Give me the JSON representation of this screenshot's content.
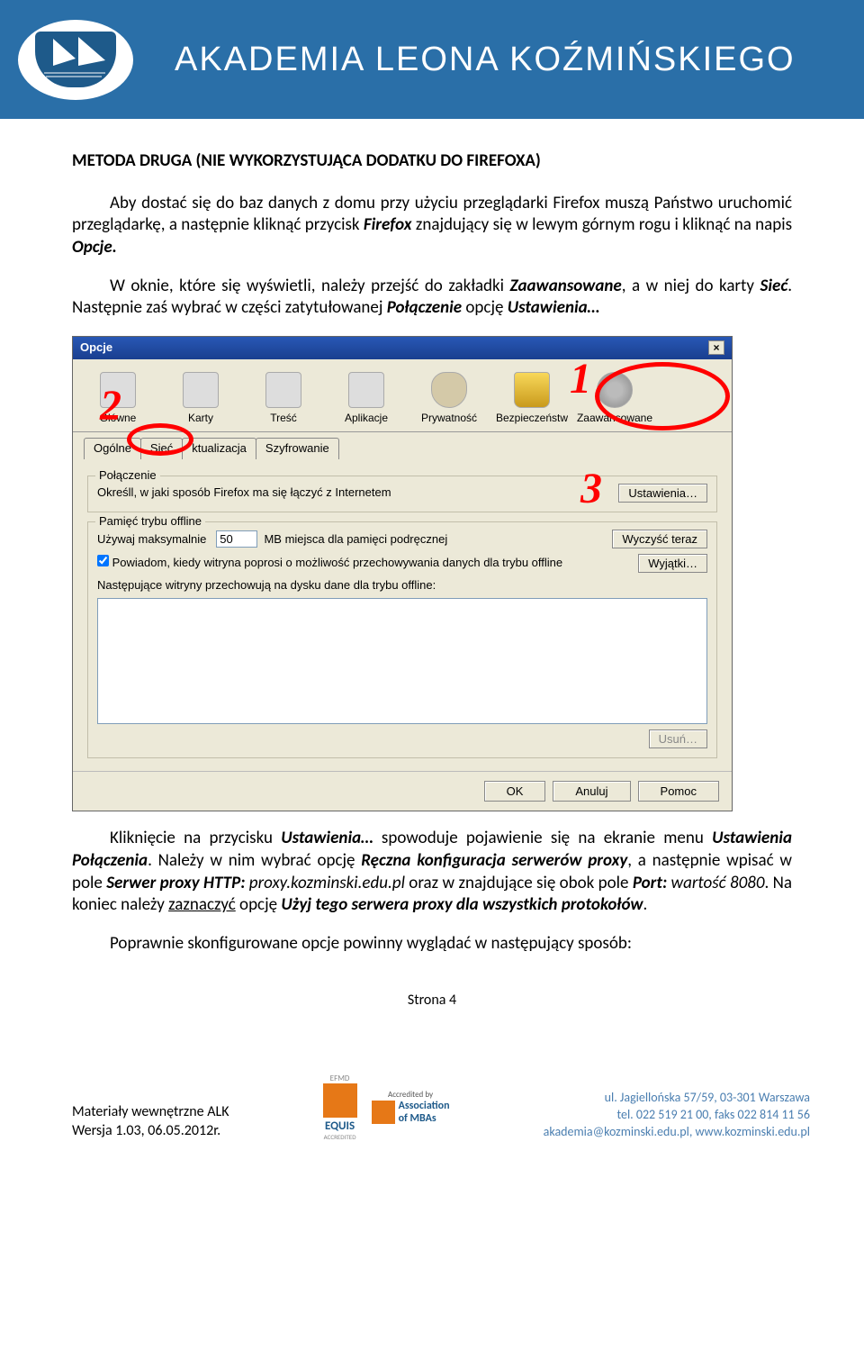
{
  "header": {
    "org_name": "AKADEMIA LEONA KOŹMIŃSKIEGO"
  },
  "content": {
    "heading": "METODA DRUGA (NIE WYKORZYSTUJĄCA DODATKU DO FIREFOXA)",
    "p1_a": "Aby dostać się do baz danych z domu przy użyciu przeglądarki Firefox muszą Państwo uruchomić przeglądarkę, a następnie kliknąć przycisk ",
    "p1_firefox": "Firefox",
    "p1_b": " znajdujący się w lewym górnym rogu i kliknąć na napis ",
    "p1_opcje": "Opcje.",
    "p2_a": "W oknie, które się wyświetli, należy przejść do zakładki ",
    "p2_zaaw": "Zaawansowane",
    "p2_b": ", a w niej do karty ",
    "p2_siec": "Sieć",
    "p2_c": ". Następnie zaś wybrać w części zatytułowanej ",
    "p2_pol": "Połączenie",
    "p2_d": " opcję ",
    "p2_ust": "Ustawienia…",
    "p3_a": "Kliknięcie na przycisku ",
    "p3_ust": "Ustawienia…",
    "p3_b": " spowoduje pojawienie się na ekranie menu ",
    "p3_ustpol": "Ustawienia Połączenia",
    "p3_c": ". Należy w nim wybrać opcję ",
    "p3_reczna": "Ręczna konfiguracja serwerów proxy",
    "p3_d": ", a następnie wpisać w pole ",
    "p3_serwer": "Serwer proxy HTTP:",
    "p3_proxyval": " proxy.kozminski.edu.pl",
    "p3_e": " oraz w znajdujące się obok pole ",
    "p3_port": "Port:",
    "p3_portval": " wartość 8080",
    "p3_f": ". Na koniec należy ",
    "p3_zazn": "zaznaczyć",
    "p3_g": " opcję ",
    "p3_uzyj": "Użyj tego serwera proxy dla wszystkich protokołów",
    "p3_h": ".",
    "p4": "Poprawnie skonfigurowane opcje powinny wyglądać w następujący sposób:"
  },
  "dialog": {
    "title": "Opcje",
    "close": "×",
    "toolbar": {
      "main": "Główne",
      "tabs": "Karty",
      "content": "Treść",
      "apps": "Aplikacje",
      "privacy": "Prywatność",
      "security": "Bezpieczeństw",
      "advanced": "Zaawansowane"
    },
    "subtabs": {
      "general": "Ogólne",
      "network": "Sieć",
      "update": "ktualizacja",
      "encryption": "Szyfrowanie"
    },
    "connection": {
      "legend": "Połączenie",
      "desc": "Określl, w jaki sposób Firefox ma się łączyć z Internetem",
      "btn": "Ustawienia…"
    },
    "offline": {
      "legend": "Pamięć trybu offline",
      "use_max": "Używaj maksymalnie",
      "mb_value": "50",
      "mb_suffix": "MB miejsca dla pamięci podręcznej",
      "clear": "Wyczyść teraz",
      "notify": "Powiadom, kiedy witryna poprosi o możliwość przechowywania danych dla trybu offline",
      "exceptions": "Wyjątki…",
      "list_label": "Następujące witryny przechowują na dysku dane dla trybu offline:",
      "remove": "Usuń…"
    },
    "footer": {
      "ok": "OK",
      "cancel": "Anuluj",
      "help": "Pomoc"
    },
    "anno": {
      "n1": "1",
      "n2": "2",
      "n3": "3"
    }
  },
  "footer": {
    "page_label": "Strona 4",
    "left1": "Materiały wewnętrzne ALK",
    "left2": "Wersja 1.03, 06.05.2012r.",
    "logo1_top": "EFMD",
    "logo1": "EQUIS",
    "logo1_sub": "ACCREDITED",
    "logo2_top": "Accredited by",
    "logo2a": "Association",
    "logo2b": "of MBAs",
    "addr1": "ul. Jagiellońska 57/59, 03-301 Warszawa",
    "addr2": "tel. 022 519 21 00, faks 022 814 11 56",
    "addr3": "akademia@kozminski.edu.pl, www.kozminski.edu.pl"
  }
}
